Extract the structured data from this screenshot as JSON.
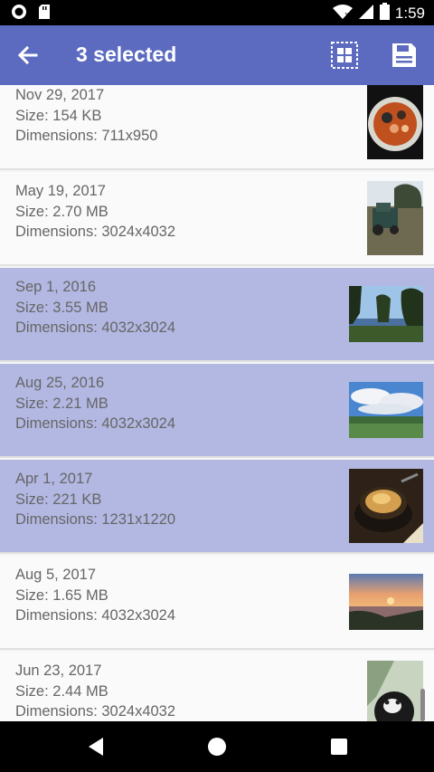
{
  "status_bar": {
    "time": "1:59"
  },
  "app_bar": {
    "title": "3 selected"
  },
  "items": [
    {
      "date": "Nov 29, 2017",
      "size": "Size: 154 KB",
      "dimensions": "Dimensions: 711x950",
      "selected": false,
      "thumb": "soup-bowl"
    },
    {
      "date": "May 19, 2017",
      "size": "Size: 2.70 MB",
      "dimensions": "Dimensions: 3024x4032",
      "selected": false,
      "thumb": "tractor-field"
    },
    {
      "date": "Sep 1, 2016",
      "size": "Size: 3.55 MB",
      "dimensions": "Dimensions: 4032x3024",
      "selected": true,
      "thumb": "lake-trees"
    },
    {
      "date": "Aug 25, 2016",
      "size": "Size: 2.21 MB",
      "dimensions": "Dimensions: 4032x3024",
      "selected": true,
      "thumb": "cloudy-sky"
    },
    {
      "date": "Apr 1, 2017",
      "size": "Size: 221 KB",
      "dimensions": "Dimensions: 1231x1220",
      "selected": true,
      "thumb": "onion-soup"
    },
    {
      "date": "Aug 5, 2017",
      "size": "Size: 1.65 MB",
      "dimensions": "Dimensions: 4032x3024",
      "selected": false,
      "thumb": "sunset"
    },
    {
      "date": "Jun 23, 2017",
      "size": "Size: 2.44 MB",
      "dimensions": "Dimensions: 3024x4032",
      "selected": false,
      "thumb": "cat-portrait"
    }
  ],
  "colors": {
    "app_bar": "#5C6BC0",
    "selected_row": "#B2B8E2",
    "row_bg": "#fafafa",
    "text": "#666666"
  },
  "icons": {
    "back": "arrow-back-icon",
    "grid": "grid-icon",
    "save": "save-icon"
  }
}
